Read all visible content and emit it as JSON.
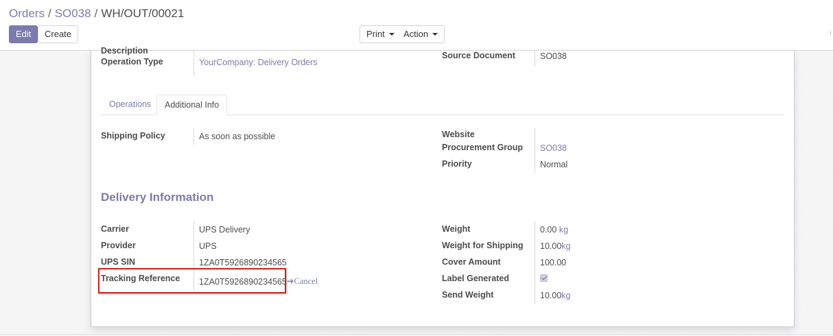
{
  "breadcrumb": {
    "orders": "Orders",
    "sale_order": "SO038",
    "current": "WH/OUT/00021",
    "separator": "/"
  },
  "toolbar": {
    "edit_label": "Edit",
    "create_label": "Create",
    "print_label": "Print",
    "action_label": "Action"
  },
  "header_fields": {
    "description_label": "Description",
    "operation_type_label": "Operation Type",
    "operation_type_value": "YourCompany: Delivery Orders",
    "source_document_label": "Source Document",
    "source_document_value": "SO038"
  },
  "tabs": [
    {
      "label": "Operations"
    },
    {
      "label": "Additional Info"
    }
  ],
  "additional_info": {
    "shipping_policy_label": "Shipping Policy",
    "shipping_policy_value": "As soon as possible",
    "website_label": "Website",
    "procurement_group_label": "Procurement Group",
    "procurement_group_value": "SO038",
    "priority_label": "Priority",
    "priority_value": "Normal"
  },
  "delivery": {
    "title": "Delivery Information",
    "carrier_label": "Carrier",
    "carrier_value": "UPS Delivery",
    "provider_label": "Provider",
    "provider_value": "UPS",
    "ups_sin_label": "UPS SIN",
    "ups_sin_value": "1ZA0T5926890234565",
    "tracking_label": "Tracking Reference",
    "tracking_value": "1ZA0T5926890234565",
    "cancel_label": "Cancel",
    "weight_label": "Weight",
    "weight_value": "0.00",
    "weight_unit": "kg",
    "weight_shipping_label": "Weight for Shipping",
    "weight_shipping_value": "10.00",
    "weight_shipping_unit": "kg",
    "cover_amount_label": "Cover Amount",
    "cover_amount_value": "100.00",
    "label_generated_label": "Label Generated",
    "label_generated_checked": true,
    "send_weight_label": "Send Weight",
    "send_weight_value": "10.00",
    "send_weight_unit": "kg"
  },
  "colors": {
    "accent": "#7c7bad",
    "highlight": "#cc1f1f"
  }
}
